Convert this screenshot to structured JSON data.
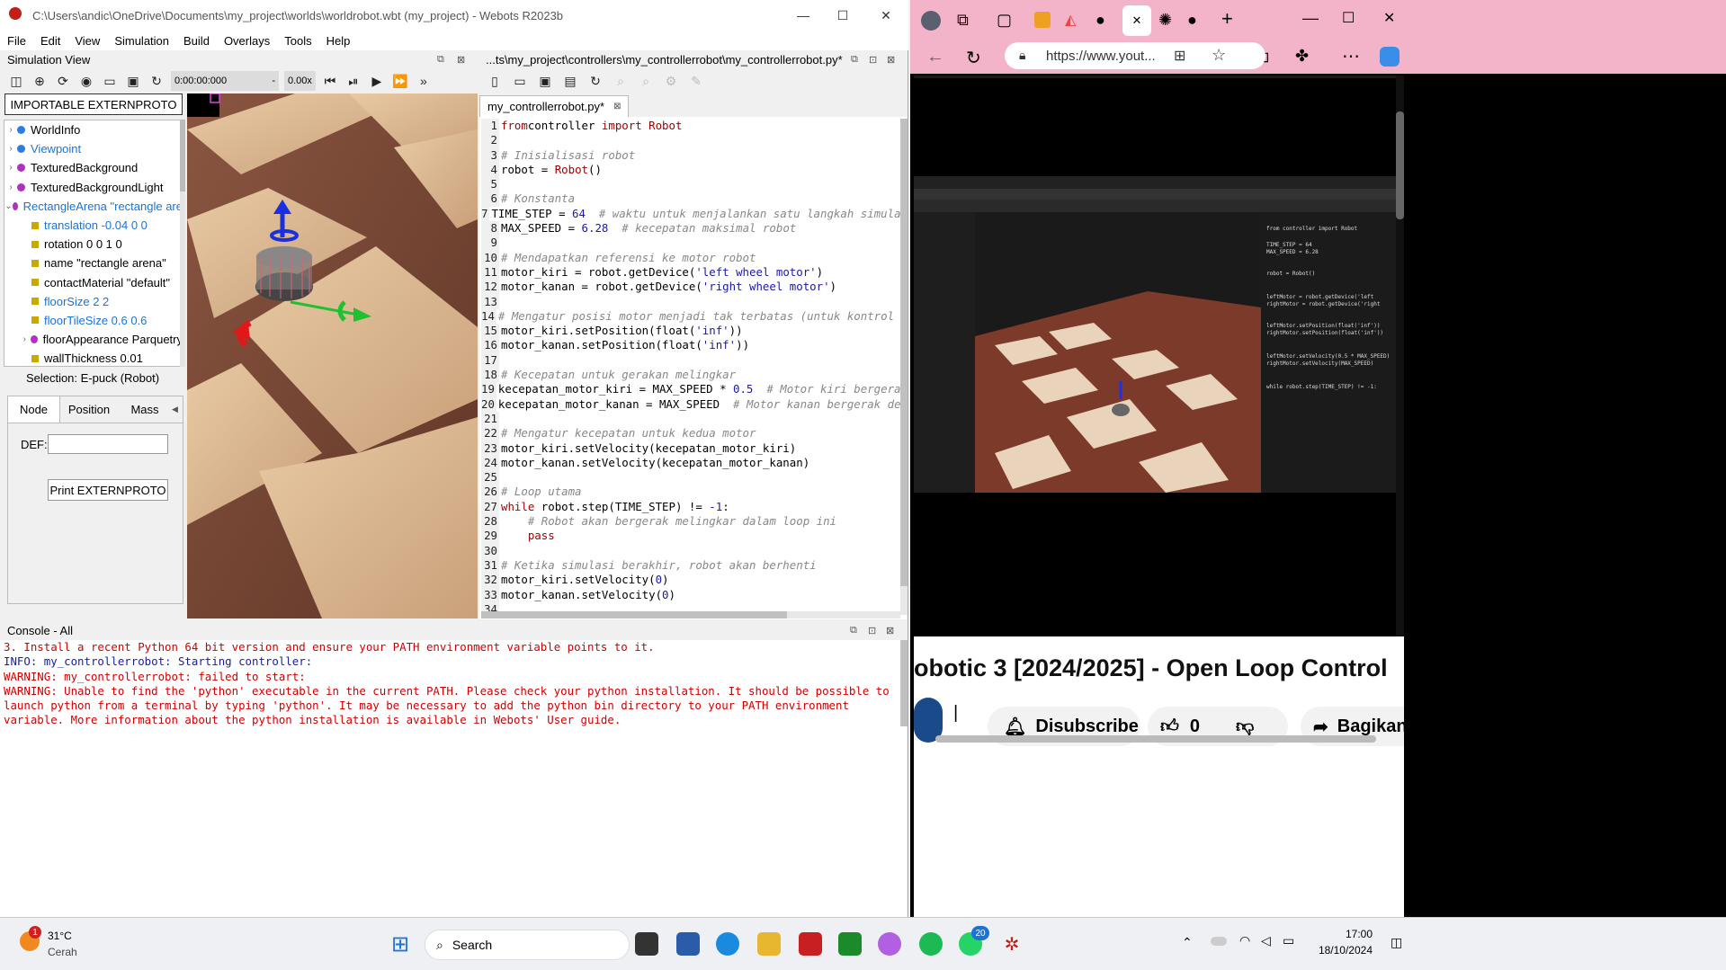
{
  "webots": {
    "title": "C:\\Users\\andic\\OneDrive\\Documents\\my_project\\worlds\\worldrobot.wbt (my_project) - Webots R2023b",
    "menu": [
      "File",
      "Edit",
      "View",
      "Simulation",
      "Build",
      "Overlays",
      "Tools",
      "Help"
    ],
    "sim_view_label": "Simulation View",
    "time": "0:00:00:000",
    "speed_sep": "-",
    "speed": "0.00x",
    "importable_button": "IMPORTABLE EXTERNPROTO",
    "tree": [
      {
        "label": "WorldInfo",
        "color": "#2a7de1",
        "expand": ">",
        "type": "dot",
        "indent": 0,
        "link": false
      },
      {
        "label": "Viewpoint",
        "color": "#2a7de1",
        "expand": ">",
        "type": "dot",
        "indent": 0,
        "link": true
      },
      {
        "label": "TexturedBackground",
        "color": "#b030c0",
        "expand": ">",
        "type": "dot",
        "indent": 0,
        "link": false
      },
      {
        "label": "TexturedBackgroundLight",
        "color": "#b030c0",
        "expand": ">",
        "type": "dot",
        "indent": 0,
        "link": false
      },
      {
        "label": "RectangleArena \"rectangle are",
        "color": "#b030c0",
        "expand": "v",
        "type": "dot",
        "indent": 0,
        "link": true
      },
      {
        "label": "translation -0.04 0 0",
        "color": "#c9a900",
        "expand": "",
        "type": "sq",
        "indent": 1,
        "link": true
      },
      {
        "label": "rotation 0 0 1 0",
        "color": "#c9a900",
        "expand": "",
        "type": "sq",
        "indent": 1,
        "link": false
      },
      {
        "label": "name \"rectangle arena\"",
        "color": "#c9a900",
        "expand": "",
        "type": "sq",
        "indent": 1,
        "link": false
      },
      {
        "label": "contactMaterial \"default\"",
        "color": "#c9a900",
        "expand": "",
        "type": "sq",
        "indent": 1,
        "link": false
      },
      {
        "label": "floorSize 2 2",
        "color": "#c9a900",
        "expand": "",
        "type": "sq",
        "indent": 1,
        "link": true
      },
      {
        "label": "floorTileSize 0.6 0.6",
        "color": "#c9a900",
        "expand": "",
        "type": "sq",
        "indent": 1,
        "link": true
      },
      {
        "label": "floorAppearance Parquetry",
        "color": "#b030c0",
        "expand": ">",
        "type": "dot",
        "indent": 1,
        "link": false
      },
      {
        "label": "wallThickness 0.01",
        "color": "#c9a900",
        "expand": "",
        "type": "sq",
        "indent": 1,
        "link": false
      }
    ],
    "selection": "Selection: E-puck (Robot)",
    "prop_tabs": [
      "Node",
      "Position",
      "Mass"
    ],
    "def_label": "DEF:",
    "def_value": "",
    "print_button": "Print EXTERNPROTO",
    "editor_path": "...ts\\my_project\\controllers\\my_controllerrobot\\my_controllerrobot.py*",
    "editor_tab": "my_controllerrobot.py*",
    "console_title": "Console - All"
  },
  "code_lines": [
    [
      [
        "kw",
        "from"
      ],
      [
        "",
        "controller "
      ],
      [
        "kw",
        "import"
      ],
      [
        "kw",
        " Robot"
      ]
    ],
    [],
    [
      [
        "cm",
        "# Inisialisasi robot"
      ]
    ],
    [
      [
        "",
        "robot = "
      ],
      [
        "kw",
        "Robot"
      ],
      [
        "",
        "()"
      ]
    ],
    [],
    [
      [
        "cm",
        "# Konstanta"
      ]
    ],
    [
      [
        "",
        "TIME_STEP = "
      ],
      [
        "nm",
        "64"
      ],
      [
        "cm",
        "  # waktu untuk menjalankan satu langkah simulasi"
      ]
    ],
    [
      [
        "",
        "MAX_SPEED = "
      ],
      [
        "nm",
        "6.28"
      ],
      [
        "cm",
        "  # kecepatan maksimal robot"
      ]
    ],
    [],
    [
      [
        "cm",
        "# Mendapatkan referensi ke motor robot"
      ]
    ],
    [
      [
        "",
        "motor_kiri = robot.getDevice("
      ],
      [
        "st",
        "'left wheel motor'"
      ],
      [
        "",
        ")"
      ]
    ],
    [
      [
        "",
        "motor_kanan = robot.getDevice("
      ],
      [
        "st",
        "'right wheel motor'"
      ],
      [
        "",
        ")"
      ]
    ],
    [],
    [
      [
        "cm",
        "# Mengatur posisi motor menjadi tak terbatas (untuk kontrol kecepatan)"
      ]
    ],
    [
      [
        "",
        "motor_kiri.setPosition(float("
      ],
      [
        "st",
        "'inf'"
      ],
      [
        "",
        "))"
      ]
    ],
    [
      [
        "",
        "motor_kanan.setPosition(float("
      ],
      [
        "st",
        "'inf'"
      ],
      [
        "",
        "))"
      ]
    ],
    [],
    [
      [
        "cm",
        "# Kecepatan untuk gerakan melingkar"
      ]
    ],
    [
      [
        "",
        "kecepatan_motor_kiri = MAX_SPEED * "
      ],
      [
        "nm",
        "0.5"
      ],
      [
        "cm",
        "  # Motor kiri bergerak lebih lambat"
      ]
    ],
    [
      [
        "",
        "kecepatan_motor_kanan = MAX_SPEED"
      ],
      [
        "cm",
        "  # Motor kanan bergerak dengan kecepatan penuh"
      ]
    ],
    [],
    [
      [
        "cm",
        "# Mengatur kecepatan untuk kedua motor"
      ]
    ],
    [
      [
        "",
        "motor_kiri.setVelocity(kecepatan_motor_kiri)"
      ]
    ],
    [
      [
        "",
        "motor_kanan.setVelocity(kecepatan_motor_kanan)"
      ]
    ],
    [],
    [
      [
        "cm",
        "# Loop utama"
      ]
    ],
    [
      [
        "kw",
        "while"
      ],
      [
        "",
        " robot.step(TIME_STEP) != "
      ],
      [
        "nm",
        "-1"
      ],
      [
        "",
        ":"
      ]
    ],
    [
      [
        "cm",
        "    # Robot akan bergerak melingkar dalam loop ini"
      ]
    ],
    [
      [
        "kw",
        "    pass"
      ]
    ],
    [],
    [
      [
        "cm",
        "# Ketika simulasi berakhir, robot akan berhenti"
      ]
    ],
    [
      [
        "",
        "motor_kiri.setVelocity("
      ],
      [
        "nm",
        "0"
      ],
      [
        "",
        ")"
      ]
    ],
    [
      [
        "",
        "motor_kanan.setVelocity("
      ],
      [
        "nm",
        "0"
      ],
      [
        "",
        ")"
      ]
    ],
    []
  ],
  "console_lines": [
    {
      "cls": "err",
      "text": "3. Install a recent Python 64 bit version and ensure your PATH environment variable points to it."
    },
    {
      "cls": "info",
      "text": "INFO: my_controllerrobot: Starting controller:"
    },
    {
      "cls": "err",
      "text": "WARNING: my_controllerrobot: failed to start:"
    },
    {
      "cls": "err",
      "text": "WARNING: Unable to find the 'python' executable in the current PATH. Please check your python installation. It should be possible to launch python from a terminal by typing 'python'. It may be necessary to add the python bin directory to your PATH environment variable. More information about the python installation is available in Webots' User guide."
    }
  ],
  "browser": {
    "url": "https://www.yout...",
    "video_title": "obotic 3 [2024/2025] - Open Loop Control",
    "subscribe": "Disubscribe",
    "likes": "0",
    "share": "Bagikan",
    "channel_placeholder": "|"
  },
  "taskbar": {
    "temp": "31°C",
    "weather": "Cerah",
    "weather_badge": "1",
    "search": "Search",
    "whatsapp_badge": "20",
    "time": "17:00",
    "date": "18/10/2024"
  },
  "colors": {
    "tab_pink": "#f3b3c8",
    "error_red": "#d00000",
    "info_blue": "#1a1aa6",
    "keyword": "#a50000"
  }
}
